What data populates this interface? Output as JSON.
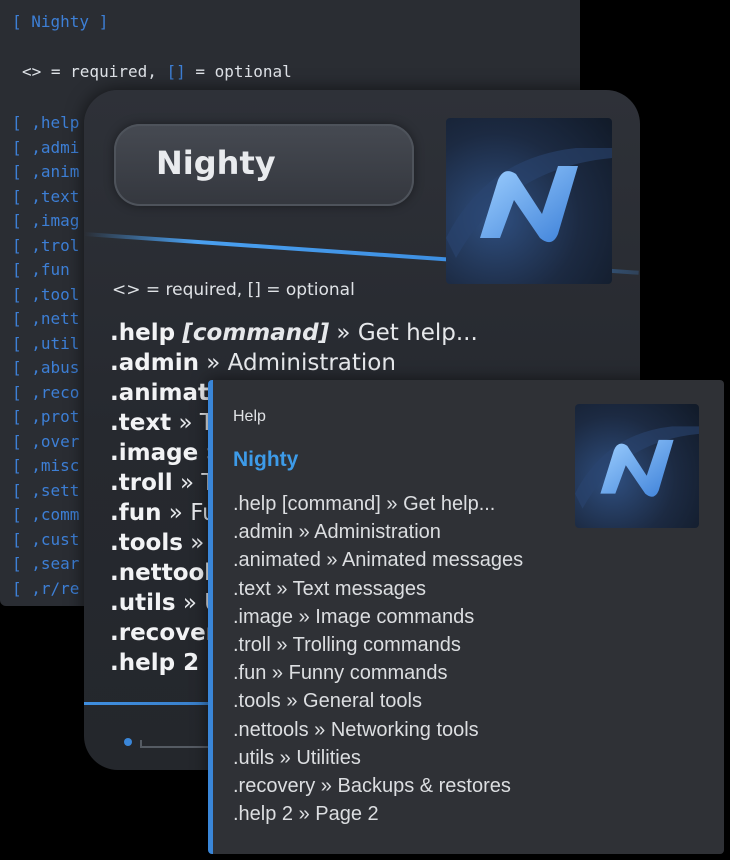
{
  "code_block": {
    "title": "[ Nighty ]",
    "legend_prefix": "<> = required, ",
    "legend_optional_brackets": "[]",
    "legend_suffix": " = optional",
    "rows": [
      "[ ,help",
      "[ ,admi",
      "[ ,anim",
      "[ ,text",
      "[ ,imag",
      "[ ,trol",
      "[ ,fun",
      "[ ,tool",
      "[ ,nett",
      "[ ,util",
      "[ ,abus",
      "[ ,reco",
      "[ ,prot",
      "[ ,over",
      "[ ,misc",
      "[ ,sett",
      "[ ,comm",
      "[ ,cust",
      "[ ,sear",
      "[ ,r/re"
    ]
  },
  "fancy_embed": {
    "title": "Nighty",
    "legend": "<> = required, [] = optional",
    "rows": [
      {
        "cmd": ".help",
        "arg": "[command]",
        "desc": " » Get help..."
      },
      {
        "cmd": ".admin",
        "arg": "",
        "desc": " » Administration"
      },
      {
        "cmd": ".animate",
        "arg": "",
        "desc": ""
      },
      {
        "cmd": ".text",
        "arg": "",
        "desc": " » Te"
      },
      {
        "cmd": ".image",
        "arg": "",
        "desc": " »"
      },
      {
        "cmd": ".troll",
        "arg": "",
        "desc": " » Tr"
      },
      {
        "cmd": ".fun",
        "arg": "",
        "desc": " » Fu"
      },
      {
        "cmd": ".tools",
        "arg": "",
        "desc": " » G"
      },
      {
        "cmd": ".nettools",
        "arg": "",
        "desc": ""
      },
      {
        "cmd": ".utils",
        "arg": "",
        "desc": " » U"
      },
      {
        "cmd": ".recover",
        "arg": "",
        "desc": ""
      },
      {
        "cmd": ".help 2",
        "arg": "",
        "desc": " »"
      }
    ]
  },
  "discord_embed": {
    "author": "Help",
    "title": "Nighty",
    "accent_color": "#3a86d8",
    "title_color": "#3d9be9",
    "rows": [
      ".help [command] » Get help...",
      ".admin » Administration",
      ".animated » Animated messages",
      ".text » Text messages",
      ".image » Image commands",
      ".troll » Trolling commands",
      ".fun » Funny commands",
      ".tools » General tools",
      ".nettools » Networking tools",
      ".utils » Utilities",
      ".recovery » Backups & restores",
      ".help 2 » Page 2"
    ]
  },
  "logo_icon": "nighty-n-logo-icon"
}
